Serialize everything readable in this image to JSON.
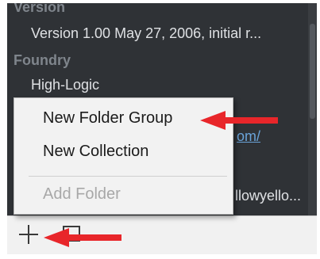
{
  "details": {
    "version_label": "Version",
    "version_value": "Version 1.00 May 27, 2006, initial r...",
    "foundry_label": "Foundry",
    "foundry_value": "High-Logic",
    "link_fragment": "om/",
    "trailing_fragment": "llowyello..."
  },
  "menu": {
    "items": [
      {
        "label": "New Folder Group",
        "enabled": true
      },
      {
        "label": "New Collection",
        "enabled": true
      },
      {
        "label": "Add Folder",
        "enabled": false
      }
    ]
  },
  "bottom_bar": {
    "add_icon": "plus-icon",
    "collection_icon": "square-icon"
  },
  "annotations": {
    "arrow_color": "#e8262a"
  },
  "colors": {
    "panel_bg": "#2f3236",
    "field_label": "#7f858c",
    "field_value": "#dfe1e4",
    "link": "#6aa3d8"
  }
}
